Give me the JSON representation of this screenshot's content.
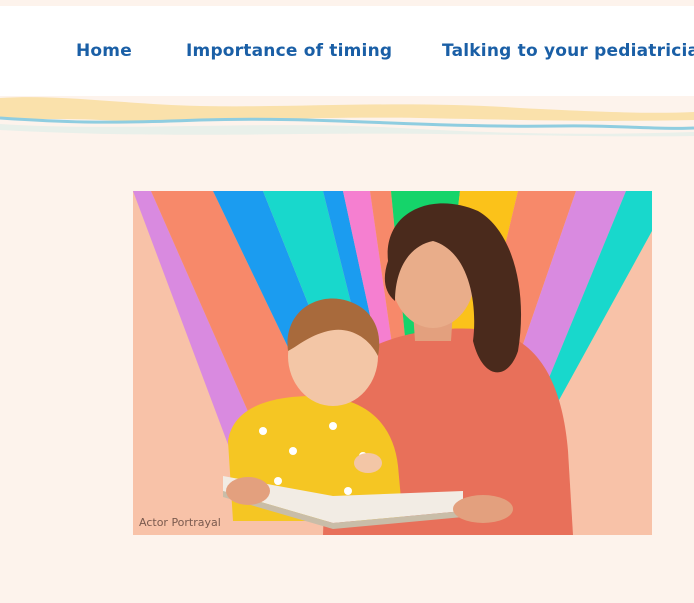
{
  "nav": {
    "items": [
      {
        "label": "Home"
      },
      {
        "label": "Importance of timing"
      },
      {
        "label": "Talking to your pediatrician"
      }
    ]
  },
  "hero": {
    "caption": "Actor Portrayal",
    "image": "mother-and-child-reading-book-rainbow-rays"
  },
  "colors": {
    "nav_link": "#1a5fa6",
    "background": "#fdf3ec",
    "wave_yellow": "#f9dda0",
    "wave_blue": "#8fcde0"
  }
}
